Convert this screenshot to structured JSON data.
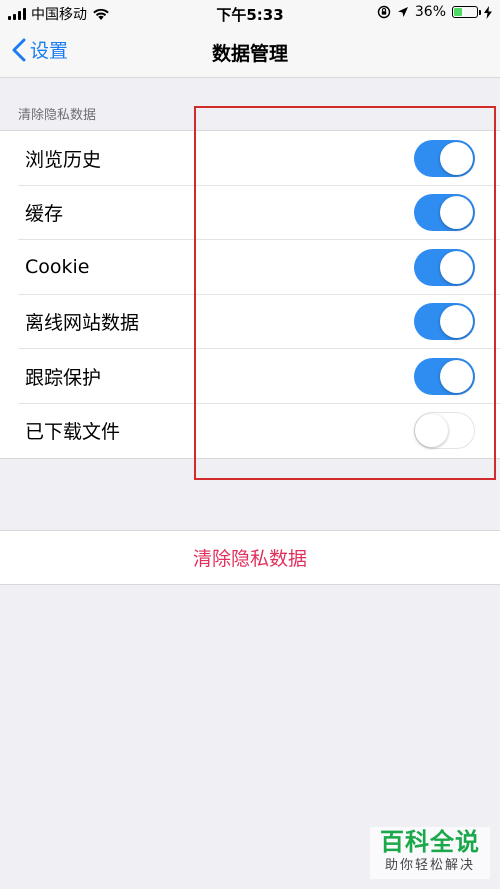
{
  "status_bar": {
    "carrier": "中国移动",
    "time": "下午5:33",
    "battery_percent": "36%",
    "battery_level": 0.36,
    "icons": [
      "signal-bars-icon",
      "wifi-icon",
      "orientation-lock-icon",
      "location-arrow-icon",
      "battery-icon",
      "charging-bolt-icon"
    ]
  },
  "nav": {
    "back_label": "设置",
    "title": "数据管理"
  },
  "section": {
    "header": "清除隐私数据",
    "items": [
      {
        "label": "浏览历史",
        "enabled": true
      },
      {
        "label": "缓存",
        "enabled": true
      },
      {
        "label": "Cookie",
        "enabled": true
      },
      {
        "label": "离线网站数据",
        "enabled": true
      },
      {
        "label": "跟踪保护",
        "enabled": true
      },
      {
        "label": "已下载文件",
        "enabled": false
      }
    ]
  },
  "clear_button": {
    "label": "清除隐私数据"
  },
  "watermark": {
    "main": "百科全说",
    "sub": "助你轻松解决"
  },
  "colors": {
    "accent": "#1a7cf0",
    "toggle_on": "#2f8cf0",
    "destructive": "#e0315d",
    "highlight": "#d22b2b",
    "background": "#efeff4"
  }
}
